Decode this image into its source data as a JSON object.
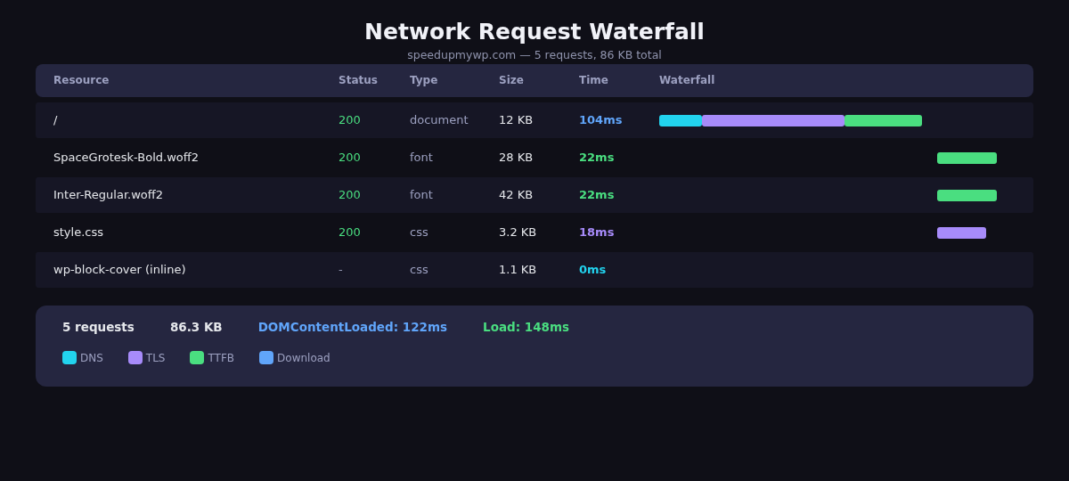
{
  "title": "Network Request Waterfall",
  "subtitle": "speedupmywp.com — 5 requests, 86 KB total",
  "table": {
    "columns": [
      "Resource",
      "Status",
      "Type",
      "Size",
      "Time",
      "Waterfall"
    ],
    "rows": [
      {
        "resource": "/",
        "status": "200",
        "ok": true,
        "type": "document",
        "size": "12 KB",
        "time": "104ms",
        "color": "#60a5fa",
        "segments": [
          {
            "color": "#22d3ee"
          },
          {
            "color": "#a78bfa"
          },
          {
            "color": "#4ade80"
          }
        ]
      },
      {
        "resource": "SpaceGrotesk-Bold.woff2",
        "status": "200",
        "ok": true,
        "type": "font",
        "size": "28 KB",
        "time": "22ms",
        "color": "#4ade80",
        "segments": [
          {
            "color": "#4ade80"
          }
        ]
      },
      {
        "resource": "Inter-Regular.woff2",
        "status": "200",
        "ok": true,
        "type": "font",
        "size": "42 KB",
        "time": "22ms",
        "color": "#4ade80",
        "segments": [
          {
            "color": "#4ade80"
          }
        ]
      },
      {
        "resource": "style.css",
        "status": "200",
        "ok": true,
        "type": "css",
        "size": "3.2 KB",
        "time": "18ms",
        "color": "#a78bfa",
        "segments": [
          {
            "color": "#a78bfa"
          }
        ]
      },
      {
        "resource": "wp-block-cover (inline)",
        "status": "-",
        "ok": false,
        "type": "css",
        "size": "1.1 KB",
        "time": "0ms",
        "color": "#22d3ee",
        "segments": []
      }
    ]
  },
  "summary": {
    "requests": "5 requests",
    "size": "86.3 KB",
    "dom": "DOMContentLoaded: 122ms",
    "load": "Load: 148ms"
  },
  "legend": [
    {
      "label": "DNS",
      "color": "#22d3ee"
    },
    {
      "label": "TLS",
      "color": "#a78bfa"
    },
    {
      "label": "TTFB",
      "color": "#4ade80"
    },
    {
      "label": "Download",
      "color": "#60a5fa"
    }
  ]
}
